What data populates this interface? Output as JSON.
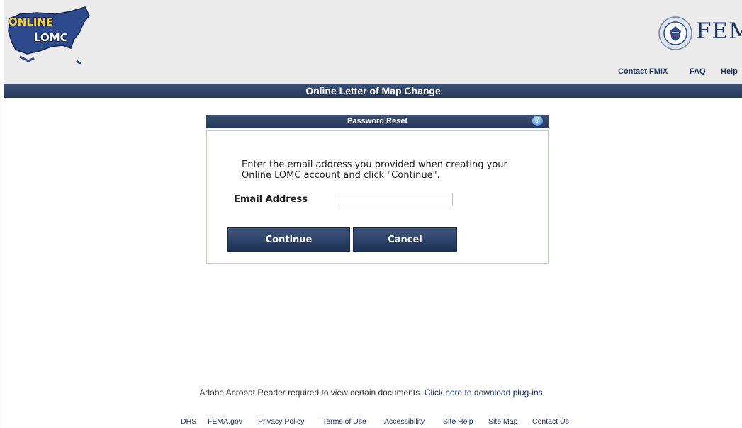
{
  "header": {
    "logo": {
      "line1": "ONLINE",
      "line2": "LOMC"
    },
    "agency_wordmark": "FEMA",
    "links": [
      "Contact FMIX",
      "FAQ",
      "Help"
    ]
  },
  "title_bar": "Online Letter of Map Change",
  "panel": {
    "title": "Password Reset",
    "help_icon": "?",
    "instructions": "Enter the email address you provided when creating your Online LOMC account and click \"Continue\".",
    "email_label": "Email Address",
    "email_value": "",
    "continue_label": "Continue",
    "cancel_label": "Cancel"
  },
  "footer": {
    "acrobat_text": "Adobe Acrobat Reader required to view certain documents.",
    "acrobat_link": "Click here to download plug-ins",
    "links": [
      "DHS",
      "FEMA.gov",
      "Privacy Policy",
      "Terms of Use",
      "Accessibility",
      "Site Help",
      "Site Map",
      "Contact Us"
    ]
  },
  "colors": {
    "header_bg": "#ebebeb",
    "navy_bar": "#2c3f62",
    "link": "#1d3560"
  },
  "icons": [
    "online-lomc-logo",
    "dhs-seal-icon",
    "help-icon"
  ]
}
